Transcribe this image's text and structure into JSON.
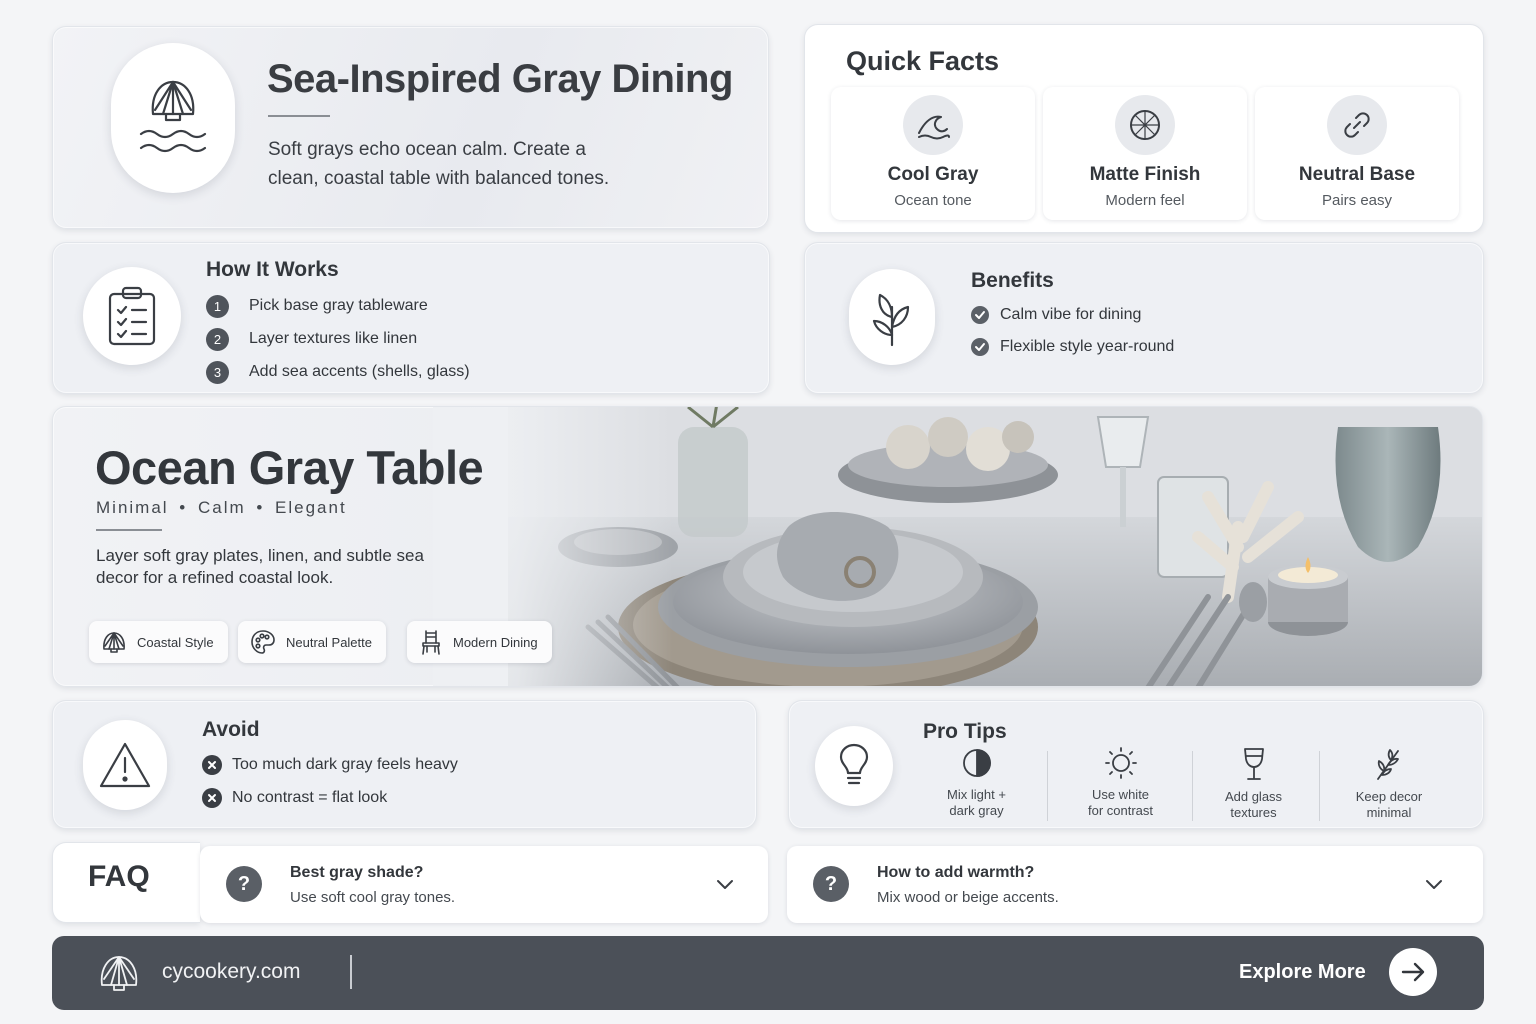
{
  "hero": {
    "title": "Sea-Inspired Gray Dining",
    "description": "Soft grays echo ocean calm. Create a clean, coastal table with balanced tones.",
    "icon": "shell-waves-icon"
  },
  "quick_facts": {
    "heading": "Quick Facts",
    "items": [
      {
        "title": "Cool Gray",
        "subtitle": "Ocean tone",
        "icon": "wave-icon"
      },
      {
        "title": "Matte Finish",
        "subtitle": "Modern feel",
        "icon": "texture-icon"
      },
      {
        "title": "Neutral Base",
        "subtitle": "Pairs easy",
        "icon": "link-icon"
      }
    ]
  },
  "how_it_works": {
    "heading": "How It Works",
    "steps": [
      {
        "num": "1",
        "text": "Pick base gray tableware"
      },
      {
        "num": "2",
        "text": "Layer textures like linen"
      },
      {
        "num": "3",
        "text": "Add sea accents (shells, glass)"
      }
    ],
    "icon": "clipboard-checklist-icon"
  },
  "benefits": {
    "heading": "Benefits",
    "items": [
      "Calm vibe for dining",
      "Flexible style year-round"
    ],
    "icon": "leaf-icon"
  },
  "feature": {
    "title": "Ocean Gray Table",
    "tagline": "Minimal  •  Calm  •  Elegant",
    "description": "Layer soft gray plates, linen, and subtle sea decor for a refined coastal look.",
    "chips": [
      {
        "label": "Coastal Style",
        "icon": "shell-icon"
      },
      {
        "label": "Neutral Palette",
        "icon": "palette-icon"
      },
      {
        "label": "Modern Dining",
        "icon": "chair-icon"
      }
    ]
  },
  "avoid": {
    "heading": "Avoid",
    "items": [
      "Too much dark gray feels heavy",
      "No contrast = flat look"
    ],
    "icon": "warning-icon"
  },
  "pro_tips": {
    "heading": "Pro Tips",
    "icon": "lightbulb-icon",
    "items": [
      {
        "text": "Mix light +\ndark gray",
        "icon": "half-circle-icon"
      },
      {
        "text": "Use white\nfor contrast",
        "icon": "sun-icon"
      },
      {
        "text": "Add glass\ntextures",
        "icon": "wine-glass-icon"
      },
      {
        "text": "Keep decor\nminimal",
        "icon": "sprig-icon"
      }
    ]
  },
  "faq": {
    "label": "FAQ",
    "items": [
      {
        "question": "Best gray shade?",
        "answer": "Use soft cool gray tones."
      },
      {
        "question": "How to add warmth?",
        "answer": "Mix wood or beige accents."
      }
    ]
  },
  "footer": {
    "site": "cycookery.com",
    "cta": "Explore More"
  },
  "colors": {
    "background": "#f4f5f7",
    "card": "#eef0f4",
    "text": "#33373c",
    "footer": "#4b5058",
    "accent_badge": "#4f545b"
  }
}
